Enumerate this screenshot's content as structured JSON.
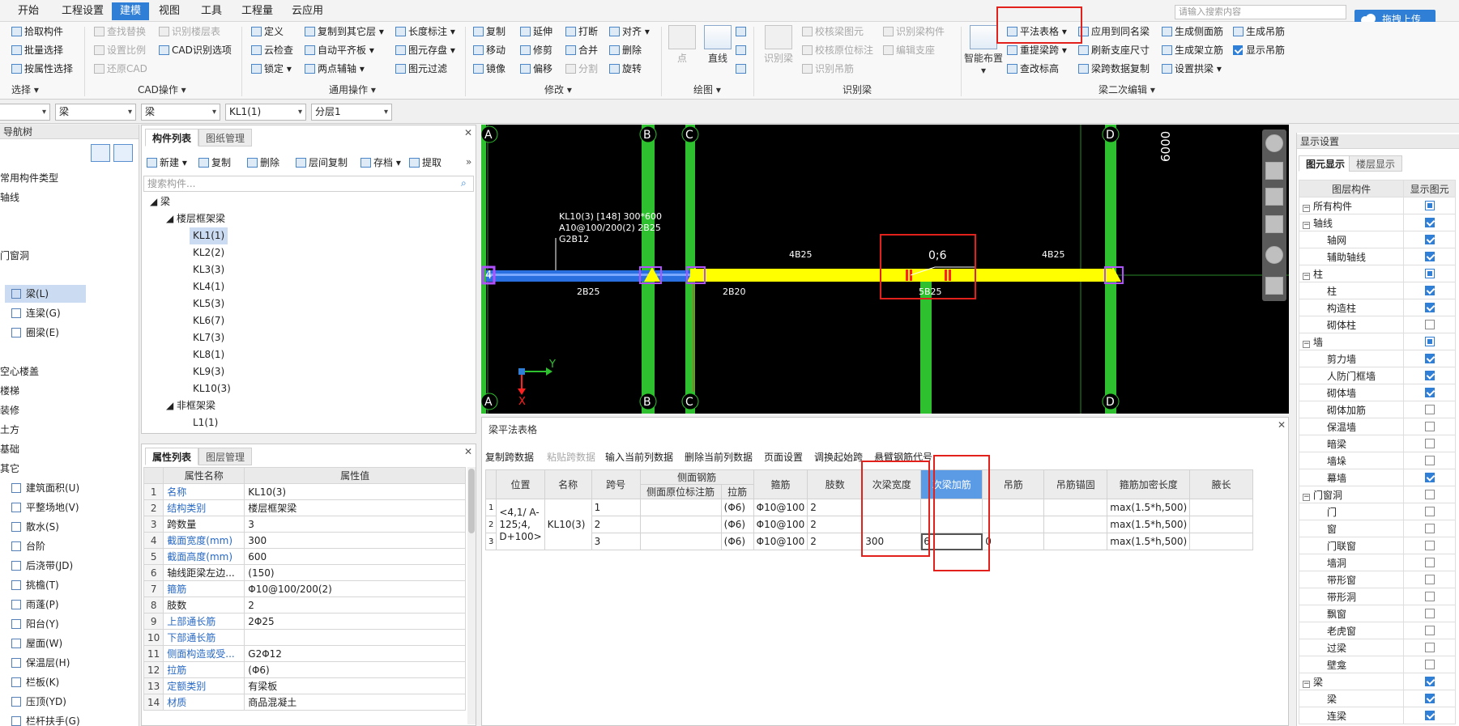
{
  "menu": [
    "开始",
    "工程设置",
    "建模",
    "视图",
    "工具",
    "工程量",
    "云应用"
  ],
  "search_placeholder": "请输入搜索内容",
  "upload": "拖拽上传",
  "ribbon": {
    "select": {
      "b1": "拾取构件",
      "b2": "批量选择",
      "b3": "按属性选择",
      "group": "选择"
    },
    "cad": {
      "b1": "查找替换",
      "b2": "识别楼层表",
      "b3": "设置比例",
      "b4": "CAD识别选项",
      "b5": "还原CAD",
      "group": "CAD操作"
    },
    "common": {
      "b1": "定义",
      "b2": "复制到其它层",
      "b3": "长度标注",
      "b4": "云检查",
      "b5": "自动平齐板",
      "b6": "图元存盘",
      "b7": "锁定",
      "b8": "两点辅轴",
      "b9": "图元过滤",
      "group": "通用操作"
    },
    "modify": {
      "b1": "复制",
      "b2": "延伸",
      "b3": "打断",
      "b4": "对齐",
      "b5": "移动",
      "b6": "修剪",
      "b7": "合并",
      "b8": "删除",
      "b9": "镜像",
      "b10": "偏移",
      "b11": "分割",
      "b12": "旋转",
      "group": "修改"
    },
    "draw": {
      "b1": "点",
      "b2": "直线",
      "group": "绘图"
    },
    "identify": {
      "b0": "识别梁",
      "b1": "校核梁图元",
      "b2": "识别梁构件",
      "b3": "校核原位标注",
      "b4": "编辑支座",
      "b5": "识别吊筋",
      "group": "识别梁"
    },
    "second": {
      "smart": "智能布置",
      "b1": "平法表格",
      "b2": "应用到同名梁",
      "b3": "生成侧面筋",
      "b4": "生成吊筋",
      "b5": "重提梁跨",
      "b6": "刷新支座尺寸",
      "b7": "生成架立筋",
      "b8": "显示吊筋",
      "b9": "查改标高",
      "b10": "梁跨数据复制",
      "b11": "设置拱梁",
      "group": "梁二次编辑"
    }
  },
  "selectors": [
    "梁",
    "梁",
    "KL1(1)",
    "分层1"
  ],
  "nav": {
    "header": "导航树",
    "items": [
      "常用构件类型",
      "轴线",
      "门窗洞",
      "梁(L)",
      "连梁(G)",
      "圈梁(E)",
      "空心楼盖",
      "楼梯",
      "装修",
      "土方",
      "基础",
      "其它",
      "建筑面积(U)",
      "平整场地(V)",
      "散水(S)",
      "台阶",
      "后浇带(JD)",
      "挑檐(T)",
      "雨蓬(P)",
      "阳台(Y)",
      "屋面(W)",
      "保温层(H)",
      "栏板(K)",
      "压顶(YD)",
      "栏杆扶手(G)"
    ]
  },
  "comp": {
    "tabs": [
      "构件列表",
      "图纸管理"
    ],
    "tools": [
      "新建",
      "复制",
      "删除",
      "层间复制",
      "存档",
      "提取"
    ],
    "search": "搜索构件...",
    "root": "梁",
    "frame": "楼层框架梁",
    "items": [
      "KL1(1)",
      "KL2(2)",
      "KL3(3)",
      "KL4(1)",
      "KL5(3)",
      "KL6(7)",
      "KL7(3)",
      "KL8(1)",
      "KL9(3)",
      "KL10(3)"
    ],
    "nonframe": "非框架梁",
    "l1": "L1(1)"
  },
  "props": {
    "tabs": [
      "属性列表",
      "图层管理"
    ],
    "h_name": "属性名称",
    "h_val": "属性值",
    "rows": [
      [
        "1",
        "名称",
        "KL10(3)"
      ],
      [
        "2",
        "结构类别",
        "楼层框架梁"
      ],
      [
        "3",
        "跨数量",
        "3"
      ],
      [
        "4",
        "截面宽度(mm)",
        "300"
      ],
      [
        "5",
        "截面高度(mm)",
        "600"
      ],
      [
        "6",
        "轴线距梁左边...",
        "(150)"
      ],
      [
        "7",
        "箍筋",
        "Φ10@100/200(2)"
      ],
      [
        "8",
        "肢数",
        "2"
      ],
      [
        "9",
        "上部通长筋",
        "2Φ25"
      ],
      [
        "10",
        "下部通长筋",
        ""
      ],
      [
        "11",
        "侧面构造或受...",
        "G2Φ12"
      ],
      [
        "12",
        "拉筋",
        "(Φ6)"
      ],
      [
        "13",
        "定额类别",
        "有梁板"
      ],
      [
        "14",
        "材质",
        "商品混凝土"
      ]
    ]
  },
  "cad": {
    "axisA": "A",
    "axisB": "B",
    "axisC": "C",
    "axisD": "D",
    "dim": "6000",
    "label1": "KL10(3) [148] 300*600",
    "label2": "A10@100/200(2) 2B25",
    "label3": "G2B12",
    "top1": "4B25",
    "top2": "4B25",
    "bot1": "2B25",
    "bot2": "2B20",
    "bot3": "5B25",
    "mark": "0;6",
    "axis4": "4",
    "ax_y": "Y",
    "ax_x": "X"
  },
  "table": {
    "title": "梁平法表格",
    "toolbar": [
      "复制跨数据",
      "粘贴跨数据",
      "输入当前列数据",
      "删除当前列数据",
      "页面设置",
      "调换起始跨",
      "悬臂钢筋代号"
    ],
    "h": {
      "pos": "位置",
      "name": "名称",
      "span": "跨号",
      "side": "侧面钢筋",
      "side1": "侧面原位标注筋",
      "tie": "拉筋",
      "stirrup": "箍筋",
      "legs": "肢数",
      "sw": "次梁宽度",
      "sa": "次梁加筋",
      "hang": "吊筋",
      "hanganc": "吊筋锚固",
      "dense": "箍筋加密长度",
      "haunch": "腋长"
    },
    "pos": "<4,1/ A-125;4, D+100>",
    "name": "KL10(3)",
    "rows": [
      {
        "n": "1",
        "span": "1",
        "tie": "(Φ6)",
        "stirrup": "Φ10@100",
        "legs": "2",
        "sw": "",
        "sa": "",
        "hang": "",
        "dense": "max(1.5*h,500)"
      },
      {
        "n": "2",
        "span": "2",
        "tie": "(Φ6)",
        "stirrup": "Φ10@100",
        "legs": "2",
        "sw": "",
        "sa": "",
        "hang": "",
        "dense": "max(1.5*h,500)"
      },
      {
        "n": "3",
        "span": "3",
        "tie": "(Φ6)",
        "stirrup": "Φ10@100",
        "legs": "2",
        "sw": "300",
        "sa": "6",
        "hang": "0",
        "dense": "max(1.5*h,500)"
      }
    ]
  },
  "right": {
    "header": "显示设置",
    "tabs": [
      "图元显示",
      "楼层显示"
    ],
    "h1": "图层构件",
    "h2": "显示图元",
    "rows": [
      [
        "所有构件",
        "g",
        "part"
      ],
      [
        "轴线",
        "g",
        "on"
      ],
      [
        "轴网",
        "c",
        "on"
      ],
      [
        "辅助轴线",
        "c",
        "on"
      ],
      [
        "柱",
        "g",
        "part"
      ],
      [
        "柱",
        "c",
        "on"
      ],
      [
        "构造柱",
        "c",
        "on"
      ],
      [
        "砌体柱",
        "c",
        ""
      ],
      [
        "墙",
        "g",
        "part"
      ],
      [
        "剪力墙",
        "c",
        "on"
      ],
      [
        "人防门框墙",
        "c",
        "on"
      ],
      [
        "砌体墙",
        "c",
        "on"
      ],
      [
        "砌体加筋",
        "c",
        ""
      ],
      [
        "保温墙",
        "c",
        ""
      ],
      [
        "暗梁",
        "c",
        ""
      ],
      [
        "墙垛",
        "c",
        ""
      ],
      [
        "幕墙",
        "c",
        "on"
      ],
      [
        "门窗洞",
        "g",
        ""
      ],
      [
        "门",
        "c",
        ""
      ],
      [
        "窗",
        "c",
        ""
      ],
      [
        "门联窗",
        "c",
        ""
      ],
      [
        "墙洞",
        "c",
        ""
      ],
      [
        "带形窗",
        "c",
        ""
      ],
      [
        "带形洞",
        "c",
        ""
      ],
      [
        "飘窗",
        "c",
        ""
      ],
      [
        "老虎窗",
        "c",
        ""
      ],
      [
        "过梁",
        "c",
        ""
      ],
      [
        "壁龛",
        "c",
        ""
      ],
      [
        "梁",
        "g",
        "on"
      ],
      [
        "梁",
        "c",
        "on"
      ],
      [
        "连梁",
        "c",
        "on"
      ]
    ]
  }
}
